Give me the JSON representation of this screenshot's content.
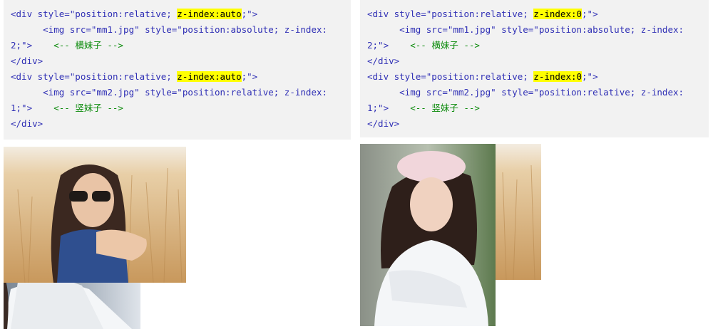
{
  "left": {
    "lines": [
      {
        "pre": "<div style=\"position:relative; ",
        "hl": "z-index:auto",
        "post": ";\">"
      },
      {
        "pre": "      <img src=\"mm1.jpg\" style=\"position:absolute; z-index:",
        "hl": "",
        "post": ""
      },
      {
        "pre": "2;\">    ",
        "hl": "",
        "post": "",
        "comment": "<-- 横妹子 -->"
      },
      {
        "pre": "</div>",
        "hl": "",
        "post": ""
      },
      {
        "pre": "<div style=\"position:relative; ",
        "hl": "z-index:auto",
        "post": ";\">"
      },
      {
        "pre": "      <img src=\"mm2.jpg\" style=\"position:relative; z-index:",
        "hl": "",
        "post": ""
      },
      {
        "pre": "1;\">    ",
        "hl": "",
        "post": "",
        "comment": "<-- 竖妹子 -->"
      },
      {
        "pre": "</div>",
        "hl": "",
        "post": ""
      }
    ]
  },
  "right": {
    "lines": [
      {
        "pre": "<div style=\"position:relative; ",
        "hl": "z-index:0",
        "post": ";\">"
      },
      {
        "pre": "      <img src=\"mm1.jpg\" style=\"position:absolute; z-index:",
        "hl": "",
        "post": ""
      },
      {
        "pre": "2;\">    ",
        "hl": "",
        "post": "",
        "comment": "<-- 横妹子 -->"
      },
      {
        "pre": "</div>",
        "hl": "",
        "post": ""
      },
      {
        "pre": "<div style=\"position:relative; ",
        "hl": "z-index:0",
        "post": ";\">"
      },
      {
        "pre": "      <img src=\"mm2.jpg\" style=\"position:relative; z-index:",
        "hl": "",
        "post": ""
      },
      {
        "pre": "1;\">    ",
        "hl": "",
        "post": "",
        "comment": "<-- 竖妹子 -->"
      },
      {
        "pre": "</div>",
        "hl": "",
        "post": ""
      }
    ]
  },
  "colors": {
    "code_bg": "#f2f2f2",
    "code_text": "#2f2fb5",
    "highlight": "#ffff00",
    "comment": "#0a8a0a"
  }
}
